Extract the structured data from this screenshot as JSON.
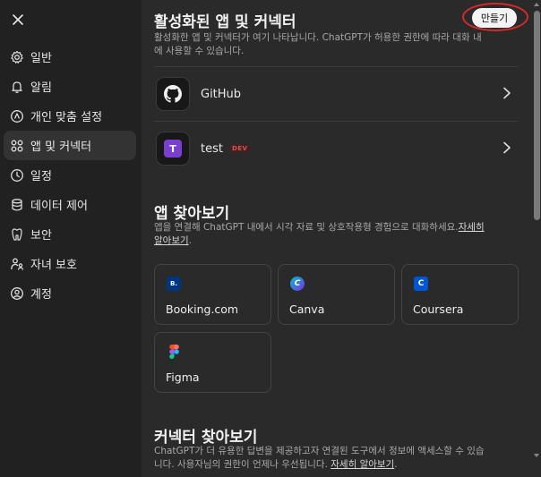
{
  "sidebar": {
    "close_icon": "close-icon",
    "items": [
      {
        "label": "일반",
        "icon": "gear-icon"
      },
      {
        "label": "알림",
        "icon": "bell-icon"
      },
      {
        "label": "개인 맞춤 설정",
        "icon": "sparkle-icon"
      },
      {
        "label": "앱 및 커넥터",
        "icon": "apps-grid-icon",
        "active": true
      },
      {
        "label": "일정",
        "icon": "clock-icon"
      },
      {
        "label": "데이터 제어",
        "icon": "database-icon"
      },
      {
        "label": "보안",
        "icon": "shield-icon"
      },
      {
        "label": "자녀 보호",
        "icon": "parent-child-icon"
      },
      {
        "label": "계정",
        "icon": "user-circle-icon"
      }
    ]
  },
  "enabled": {
    "title": "활성화된 앱 및 커넥터",
    "create_label": "만들기",
    "desc_line1": "활성화한 앱 및 커넥터가 여기 나타납니다. ChatGPT가 허용한 권한에 따라 대화 내",
    "desc_line2": "에 사용할 수 있습니다.",
    "connectors": [
      {
        "name": "GitHub",
        "icon": "github-icon"
      },
      {
        "name": "test",
        "icon": "letter-t-icon",
        "icon_letter": "T",
        "badge": "DEV"
      }
    ]
  },
  "explore_apps": {
    "title": "앱 찾아보기",
    "desc_line1": "앱을 연결해 ChatGPT 내에서 시각 자료 및 상호작용형 경험으로 대화하세요.",
    "link_part1": "자세히",
    "link_part2": "알아보기",
    "apps": [
      {
        "name": "Booking.com",
        "icon": "booking-icon",
        "glyph": "B.",
        "color": "#003580"
      },
      {
        "name": "Canva",
        "icon": "canva-icon",
        "glyph": "C",
        "color": "#7d2ae8"
      },
      {
        "name": "Coursera",
        "icon": "coursera-icon",
        "glyph": "C",
        "color": "#0056d2"
      },
      {
        "name": "Figma",
        "icon": "figma-icon",
        "glyph": "",
        "color": "#f24e1e"
      }
    ]
  },
  "explore_connectors": {
    "title": "커넥터 찾아보기",
    "desc_line1": "ChatGPT가 더 유용한 답변을 제공하고자 연결된 도구에서 정보에 액세스할 수 있습",
    "desc_line2": "니다. 사용자님의 권한이 언제나 우선됩니다.",
    "link": "자세히 알아보기"
  }
}
